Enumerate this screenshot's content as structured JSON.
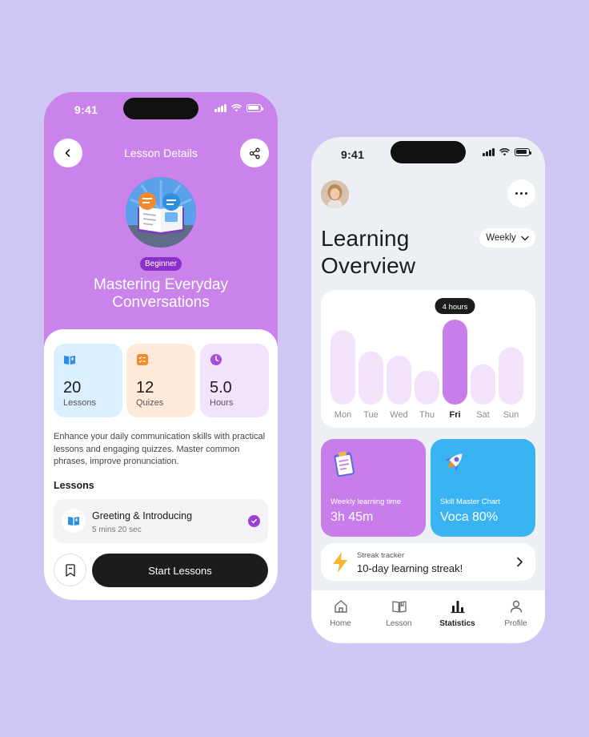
{
  "lesson_screen": {
    "status_time": "9:41",
    "header_title": "Lesson Details",
    "level_badge": "Beginner",
    "course_title": "Mastering Everyday Conversations",
    "stats": [
      {
        "value": "20",
        "label": "Lessons",
        "icon": "book-icon",
        "bg": "#dcefff",
        "accent": "#2f8fe0"
      },
      {
        "value": "12",
        "label": "Quizes",
        "icon": "quiz-checklist-icon",
        "bg": "#ffe9d9",
        "accent": "#f08a2c"
      },
      {
        "value": "5.0",
        "label": "Hours",
        "icon": "clock-icon",
        "bg": "#f1e3fb",
        "accent": "#a64fd8"
      }
    ],
    "description": "Enhance your daily communication skills with practical lessons and engaging quizzes. Master common phrases, improve pronunciation.",
    "lessons_heading": "Lessons",
    "lesson_item": {
      "title": "Greeting & Introducing",
      "duration": "5 mins 20 sec",
      "completed": true
    },
    "start_button": "Start Lessons"
  },
  "overview_screen": {
    "status_time": "9:41",
    "title_line1": "Learning",
    "title_line2": "Overview",
    "period": "Weekly",
    "chart_data": {
      "type": "bar",
      "categories": [
        "Mon",
        "Tue",
        "Wed",
        "Thu",
        "Fri",
        "Sat",
        "Sun"
      ],
      "values": [
        3.5,
        2.5,
        2.3,
        1.6,
        4.0,
        1.9,
        2.7
      ],
      "highlight_index": 4,
      "highlight_label": "4 hours",
      "colors": {
        "bar": "#f2e3fb",
        "highlight": "#c77eea",
        "label": "#8a8a8f",
        "label_active": "#1c1c1e"
      }
    },
    "tiles": [
      {
        "label": "Weekly learning time",
        "value": "3h 45m",
        "icon": "clipboard-icon",
        "bg": "#c77eea"
      },
      {
        "label": "Skill Master Chart",
        "value": "Voca 80%",
        "icon": "rocket-icon",
        "bg": "#3ab3f2"
      }
    ],
    "streak": {
      "label": "Streak tracker",
      "value": "10-day learning streak!",
      "icon": "lightning-icon"
    },
    "tabs": [
      {
        "label": "Home",
        "icon": "home-icon"
      },
      {
        "label": "Lesson",
        "icon": "book-icon"
      },
      {
        "label": "Statistics",
        "icon": "bar-chart-icon",
        "active": true
      },
      {
        "label": "Profile",
        "icon": "user-icon"
      }
    ]
  }
}
